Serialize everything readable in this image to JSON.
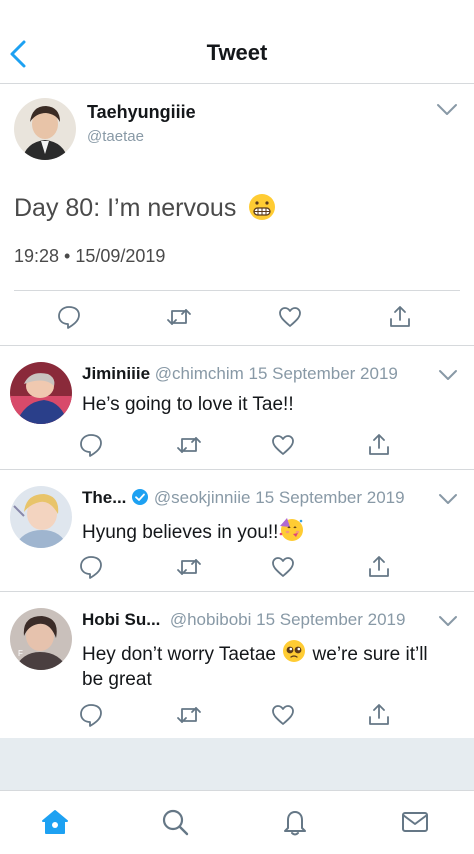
{
  "header": {
    "title": "Tweet"
  },
  "tweet": {
    "author_name": "Taehyungiiie",
    "author_handle": "@taetae",
    "text": "Day 80: I’m nervous",
    "timestamp": "19:28 • 15/09/2019"
  },
  "replies": [
    {
      "name": "Jiminiiie",
      "handle": "@chimchim",
      "date": "15 September 2019",
      "text": "He’s going to love it Tae!!",
      "verified": false
    },
    {
      "name": "The...",
      "handle": "@seokjinniie",
      "date": "15 September 2019",
      "text": "Hyung believes in you!!",
      "verified": true
    },
    {
      "name": "Hobi Su...",
      "handle": "@hobibobi",
      "date": "15 September 2019",
      "text_before": "Hey don’t worry Taetae",
      "text_after": "we’re sure it’ll be great",
      "verified": false
    }
  ],
  "colors": {
    "accent": "#1da1f2",
    "icon_gray": "#657786",
    "separator": "#d6d9dc"
  }
}
